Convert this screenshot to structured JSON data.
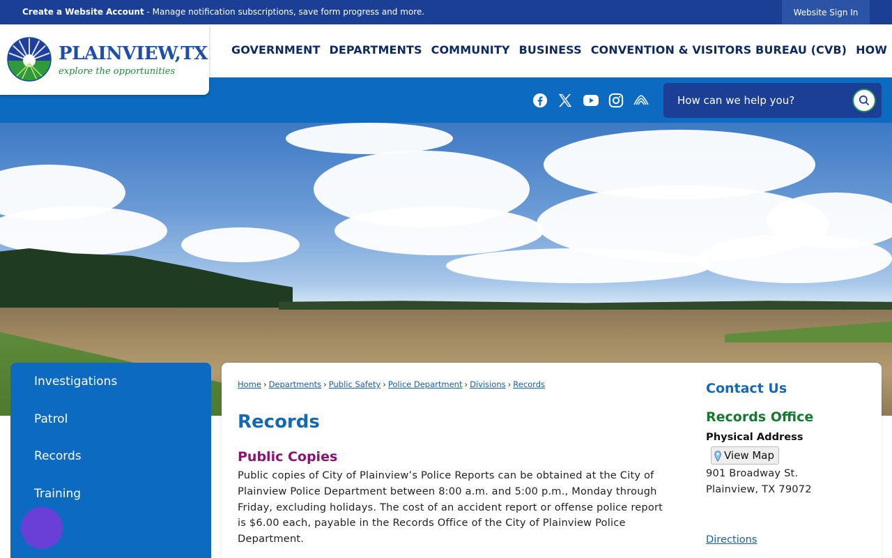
{
  "topbar": {
    "account_link": "Create a Website Account",
    "account_desc": " - Manage notification subscriptions, save form progress and more.",
    "sign_in": "Website Sign In"
  },
  "logo": {
    "name": "PLAINVIEW,TX",
    "tagline": "explore the opportunities"
  },
  "nav": {
    "items": [
      "GOVERNMENT",
      "DEPARTMENTS",
      "COMMUNITY",
      "BUSINESS",
      "CONVENTION & VISITORS BUREAU (CVB)",
      "HOW DO I..."
    ]
  },
  "social": [
    "facebook-icon",
    "x-icon",
    "youtube-icon",
    "instagram-icon",
    "agency-icon"
  ],
  "search": {
    "placeholder": "How can we help you?"
  },
  "subnav": {
    "items": [
      "Investigations",
      "Patrol",
      "Records",
      "Training"
    ]
  },
  "breadcrumb": [
    "Home",
    "Departments",
    "Public Safety",
    "Police Department",
    "Divisions",
    "Records"
  ],
  "main": {
    "title": "Records",
    "section_title": "Public Copies",
    "paragraph": "Public copies of City of Plainview’s Police Reports can be obtained at the City of Plainview Police Department between 8:00 a.m. and 5:00 p.m., Monday through Friday, excluding holidays. The cost of an accident report or offense police report is $6.00 each, payable in the Records Office of the City of Plainview Police Department."
  },
  "contact": {
    "heading": "Contact Us",
    "office": "Records Office",
    "address_label": "Physical Address",
    "map_button": "View Map",
    "address_line1": "901 Broadway St.",
    "address_line2": "Plainview, TX 79072",
    "directions": "Directions"
  },
  "colors": {
    "topbar": "#1a3f95",
    "band": "#0c6bc0",
    "nav_text": "#0d2a5c",
    "title_blue": "#1568b5",
    "section_purple": "#8a1470",
    "office_green": "#137a30",
    "chat_button": "#6a3fd8"
  }
}
